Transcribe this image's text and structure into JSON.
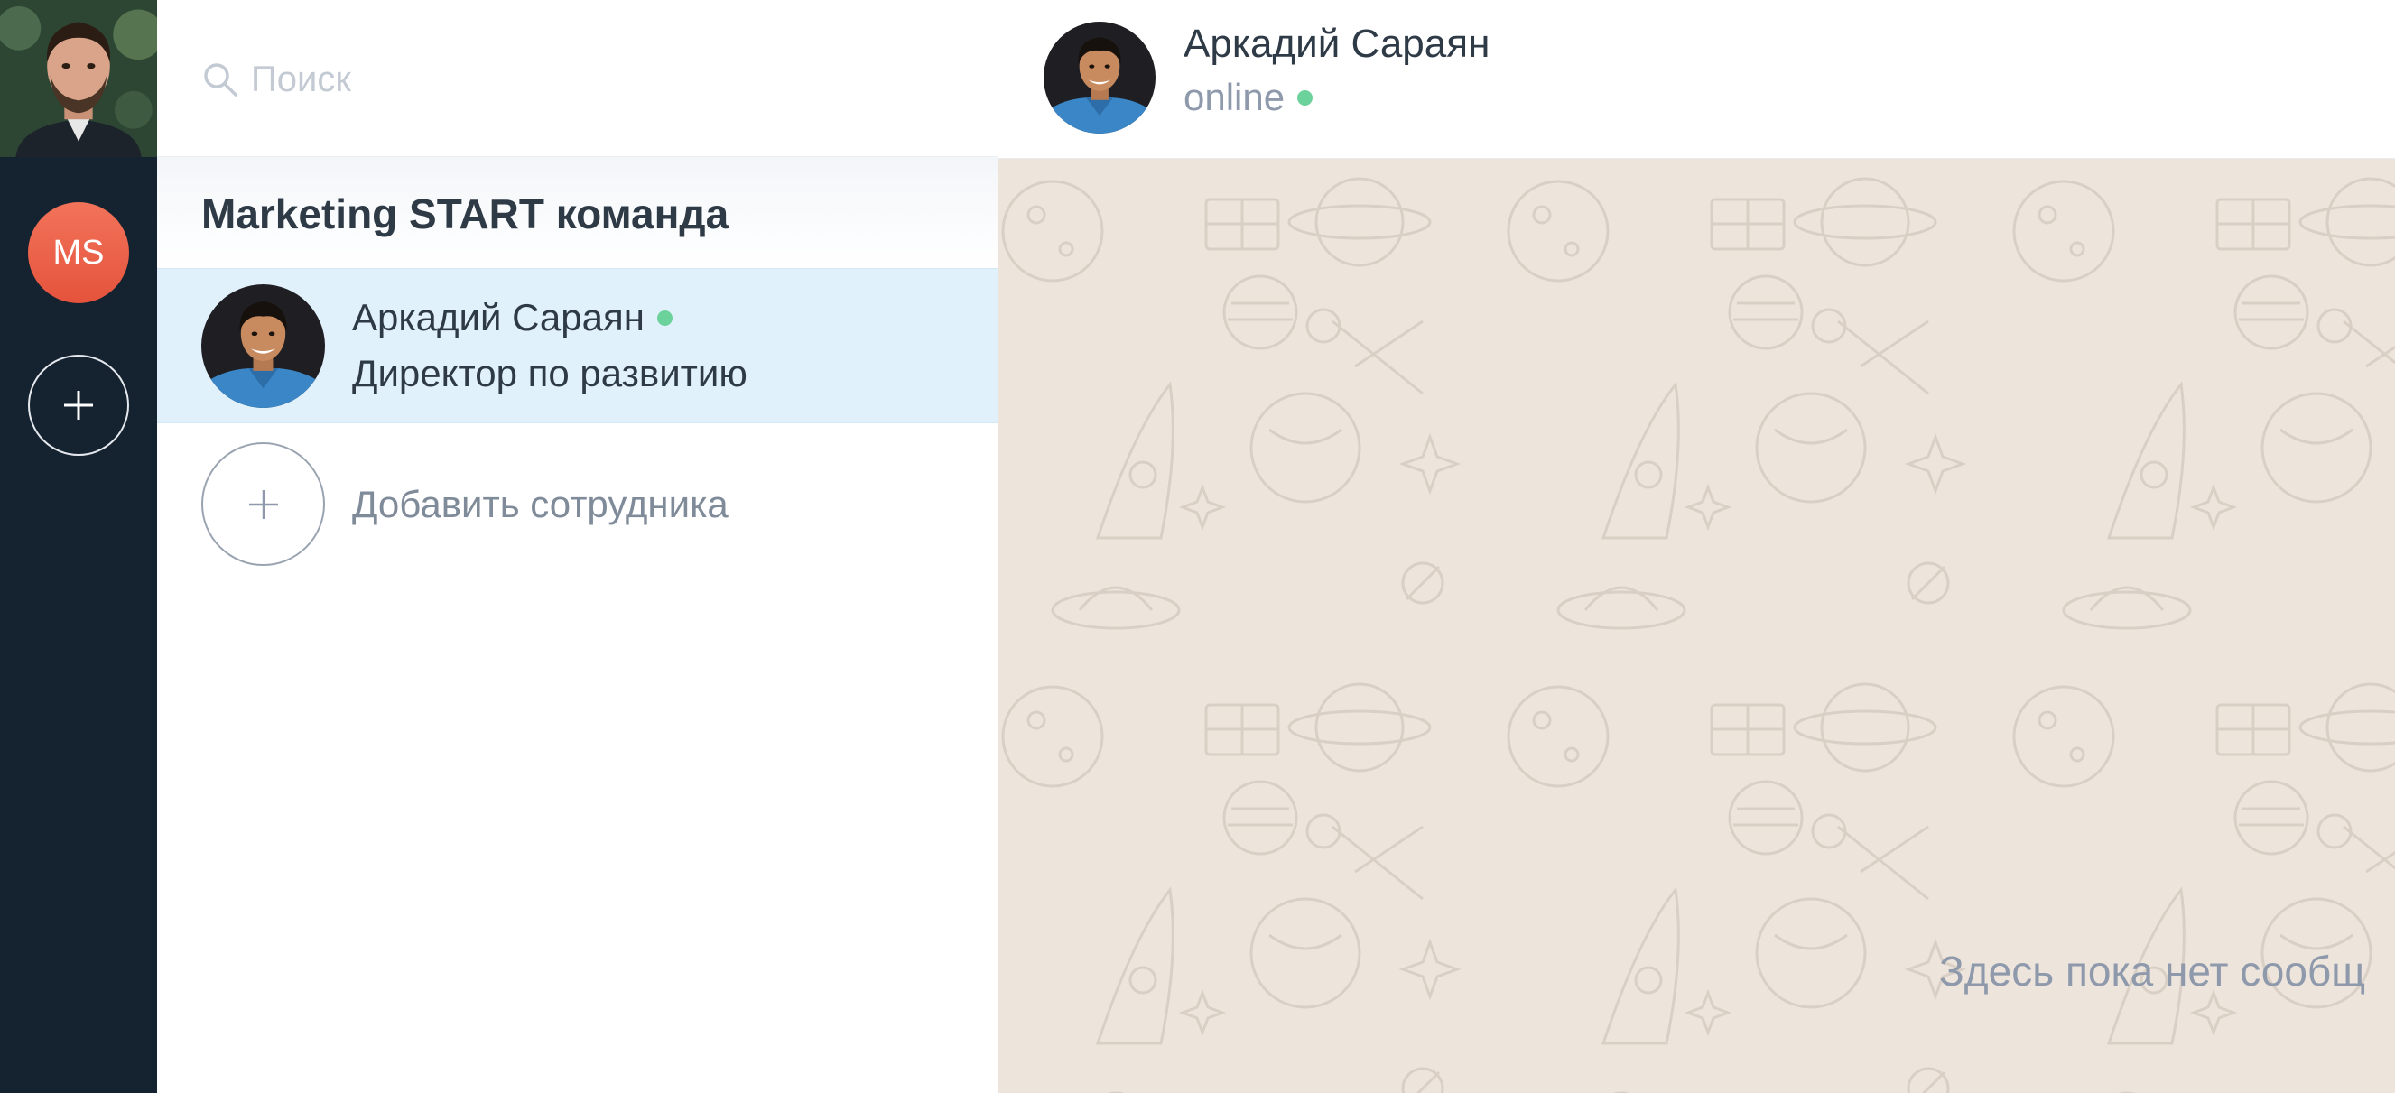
{
  "rail": {
    "workspaces": [
      {
        "initials": "MS",
        "color": "#ee6249"
      }
    ]
  },
  "search": {
    "placeholder": "Поиск"
  },
  "group": {
    "title": "Marketing START команда"
  },
  "contacts": [
    {
      "name": "Аркадий Сараян",
      "role": "Директор по развитию",
      "online": true
    }
  ],
  "add_employee": {
    "label": "Добавить сотрудника"
  },
  "chat": {
    "name": "Аркадий Сараян",
    "status": "online",
    "empty_text": "Здесь пока нет сообщ"
  },
  "colors": {
    "rail_bg": "#15222f",
    "selected_row": "#e1f1fc",
    "online": "#6cd29b",
    "chat_bg": "#ede4dc",
    "accent": "#ee6249"
  }
}
